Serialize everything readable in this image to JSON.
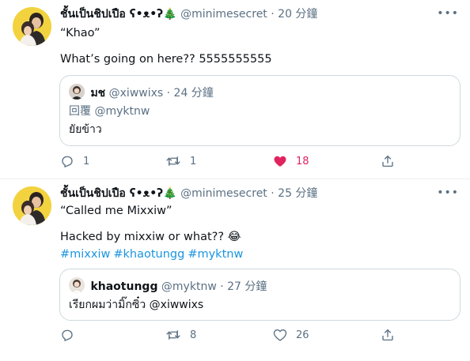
{
  "tweets": [
    {
      "author_name": "ชั้นเป็นชิปเปือ ʕ•ᴥ•ʔ🎄",
      "handle": "@minimesecret",
      "separator": "·",
      "time": "20 分鐘",
      "more": "•••",
      "lines": [
        "“Khao”",
        "What’s going on here?? 5555555555"
      ],
      "quote": {
        "author_name": "มช",
        "handle": "@xiwwixs",
        "separator": "·",
        "time": "24 分鐘",
        "reply_prefix": "回覆",
        "reply_mention": "@myktnw",
        "text": "ยัยข้าว"
      },
      "actions": {
        "reply_count": "1",
        "retweet_count": "1",
        "like_count": "18",
        "liked": true
      }
    },
    {
      "author_name": "ชั้นเป็นชิปเปือ ʕ•ᴥ•ʔ🎄",
      "handle": "@minimesecret",
      "separator": "·",
      "time": "25 分鐘",
      "more": "•••",
      "lines": [
        "“Called me Mixxiw”",
        "Hacked by mixxiw or what?? 😂"
      ],
      "hashtags": [
        "#mixxiw",
        "#khaotungg",
        "#myktnw"
      ],
      "quote": {
        "author_name": "khaotungg",
        "handle": "@myktnw",
        "separator": "·",
        "time": "27 分鐘",
        "text": "เรียกผมว่ามิ๊กซิ๋ว @xiwwixs"
      },
      "actions": {
        "reply_count": "",
        "retweet_count": "8",
        "like_count": "26",
        "liked": false
      }
    }
  ],
  "colors": {
    "text": "#0f1419",
    "secondary": "#5b7083",
    "link": "#1b95e0",
    "like": "#e0245e",
    "border": "#cfd9de",
    "avatar_bg": "#f2d33f"
  },
  "icons": [
    "reply-icon",
    "retweet-icon",
    "like-icon",
    "share-icon",
    "more-icon",
    "tree-emoji",
    "laughing-emoji"
  ]
}
